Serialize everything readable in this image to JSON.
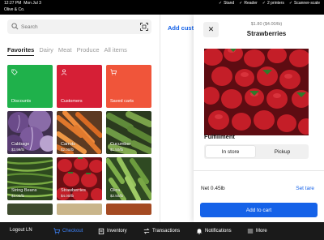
{
  "status_bar": {
    "time": "12:27 PM",
    "date": "Mon Jul 3",
    "business": "Olive & Co.",
    "devices": [
      "Stand",
      "Reader",
      "2 printers",
      "Scanner-scale"
    ],
    "battery": "100%"
  },
  "search": {
    "placeholder": "Search"
  },
  "category_tabs": [
    "Favorites",
    "Dairy",
    "Meat",
    "Produce",
    "All items"
  ],
  "active_tab": "Favorites",
  "tiles": [
    {
      "name": "Discounts",
      "price": "",
      "icon": "tag-icon",
      "color": "#1fb14b"
    },
    {
      "name": "Customers",
      "price": "",
      "icon": "person-icon",
      "color": "#d61f36"
    },
    {
      "name": "Saved carts",
      "price": "",
      "icon": "cart-icon",
      "color": "#f0553a"
    },
    {
      "name": "Cabbage",
      "price": "$3.99/lb",
      "icon": "cabbage-photo"
    },
    {
      "name": "Carrots",
      "price": "$2.00/lb",
      "icon": "carrots-photo"
    },
    {
      "name": "Cucumber",
      "price": "$1.50/lb",
      "icon": "cucumber-photo"
    },
    {
      "name": "String Beans",
      "price": "$3.00/lb",
      "icon": "string-beans-photo"
    },
    {
      "name": "Strawberries",
      "price": "$4.00/lb",
      "icon": "strawberries-photo"
    },
    {
      "name": "Okra",
      "price": "$2.50/lb",
      "icon": "okra-photo"
    }
  ],
  "middle": {
    "add_customer": "Add custo"
  },
  "drawer": {
    "price_line": "$1.80 ($4.00/lb)",
    "title": "Strawberries",
    "fulfillment_title": "Fulfillment",
    "options": [
      "In store",
      "Pickup"
    ],
    "selected_option": "In store",
    "net_label": "Net 0.45lb",
    "set_tare": "Set tare",
    "add_to_cart": "Add to cart"
  },
  "bottom_nav": {
    "logout": "Logout LN",
    "items": [
      "Checkout",
      "Inventory",
      "Transactions",
      "Notifications",
      "More"
    ],
    "active": "Checkout"
  },
  "colors": {
    "accent": "#1562e8",
    "bar": "#1a1a1a"
  }
}
